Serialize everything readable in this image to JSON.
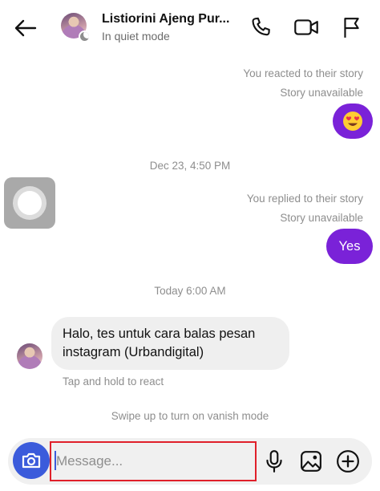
{
  "header": {
    "back_icon": "arrow-left-icon",
    "contact_name": "Listiorini Ajeng Pur...",
    "status": "In quiet mode",
    "actions": [
      "phone-icon",
      "video-camera-icon",
      "flag-icon"
    ]
  },
  "thread": {
    "story_reaction_meta": "You reacted to their story",
    "story_reaction_unavailable": "Story unavailable",
    "reaction_emoji": "heart-eyes-emoji",
    "timestamp_1": "Dec 23, 4:50 PM",
    "story_reply_meta": "You replied to their story",
    "story_reply_unavailable": "Story unavailable",
    "reply_text": "Yes",
    "timestamp_2": "Today 6:00 AM",
    "incoming_message": "Halo, tes untuk cara balas pesan instagram (Urbandigital)",
    "tap_hint": "Tap and hold to react",
    "vanish_hint": "Swipe up to turn on vanish mode"
  },
  "composer": {
    "placeholder": "Message...",
    "value": "",
    "icons": [
      "camera-icon",
      "microphone-icon",
      "gallery-icon",
      "add-circle-icon"
    ]
  },
  "colors": {
    "bubble_purple": "#7a22d8",
    "camera_blue": "#3b5bdb",
    "highlight_red": "#e0202a"
  }
}
